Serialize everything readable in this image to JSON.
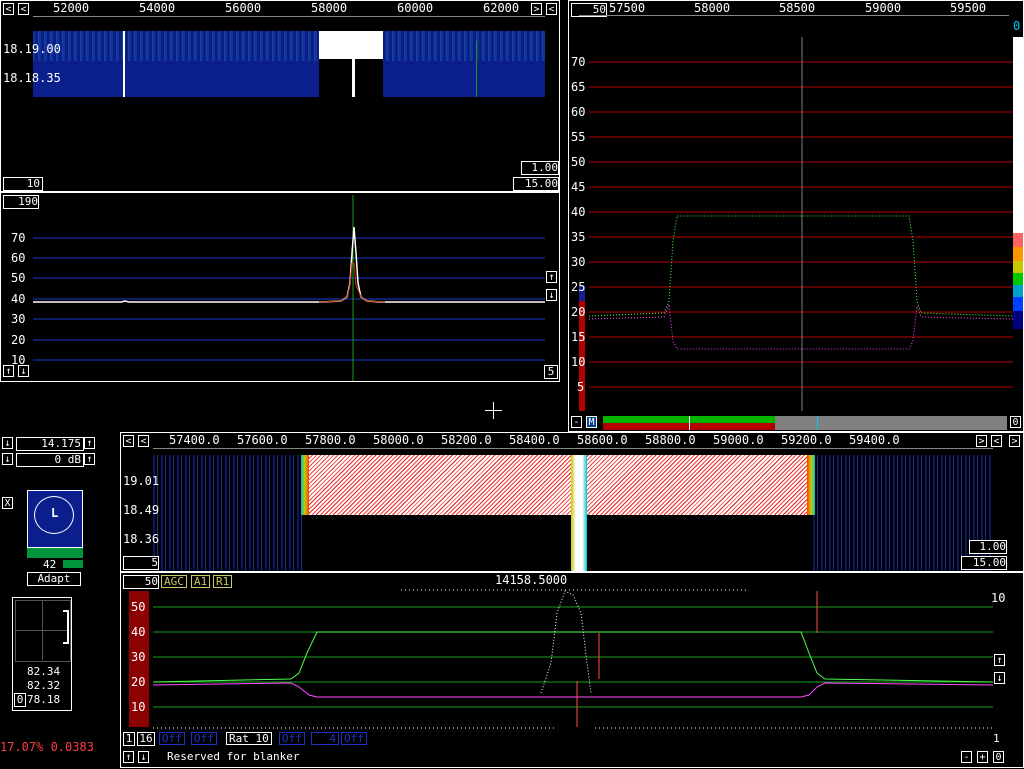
{
  "top_left": {
    "freq_ticks": [
      "52000",
      "54000",
      "56000",
      "58000",
      "60000",
      "62000"
    ],
    "wf_times": [
      "18.19.00",
      "18.18.35"
    ],
    "avg_box": "10",
    "gain_box": "1.00",
    "gain2_box": "15.00"
  },
  "spectrum_left": {
    "top_box": "190",
    "y_ticks": [
      "70",
      "60",
      "50",
      "40",
      "30",
      "20",
      "10"
    ],
    "corner_box": "5"
  },
  "top_right": {
    "avg_box": "50",
    "freq_ticks": [
      "57500",
      "58000",
      "58500",
      "59000",
      "59500"
    ],
    "y_ticks": [
      "70",
      "65",
      "60",
      "55",
      "50",
      "45",
      "40",
      "35",
      "30",
      "25",
      "20",
      "15",
      "10",
      "5"
    ],
    "scale_top": "0",
    "m_label": "M",
    "corner_left": "-",
    "corner_right": "0"
  },
  "left_controls": {
    "freq_value": "14.175",
    "db_value": "0 dB",
    "x_label": "X",
    "meter_letter": "L",
    "meter_value": "42",
    "adapt_label": "Adapt",
    "readings": [
      "82.34",
      "82.32",
      "78.18"
    ],
    "reading_prefix": "0",
    "status": "17.07% 0.0383"
  },
  "main": {
    "freq_ticks": [
      "57400.0",
      "57600.0",
      "57800.0",
      "58000.0",
      "58200.0",
      "58400.0",
      "58600.0",
      "58800.0",
      "59000.0",
      "59200.0",
      "59400.0"
    ],
    "wf_times": [
      "19.01",
      "18.49",
      "18.36"
    ],
    "avg_box": "5",
    "gain_box": "1.00",
    "gain2_box": "15.00",
    "spec_avg": "50",
    "tags": [
      "AGC",
      "A1",
      "R1"
    ],
    "center_freq": "14158.5000",
    "y_ticks": [
      "50",
      "40",
      "30",
      "20",
      "10"
    ],
    "right_label": "10",
    "bottom": {
      "b1": "1",
      "b2": "16",
      "off1": "Off",
      "off2": "Off",
      "rat": "Rat 10",
      "off3": "Off",
      "n4": "4",
      "off4": "Off",
      "page": "1",
      "blanker": "Reserved for blanker"
    }
  },
  "colors": {
    "grid_blue": "#1a3cc8",
    "grid_red": "#b40000",
    "grid_green": "#1aa01a",
    "trace_green": "#4cff4c",
    "trace_magenta": "#ff4cff"
  }
}
